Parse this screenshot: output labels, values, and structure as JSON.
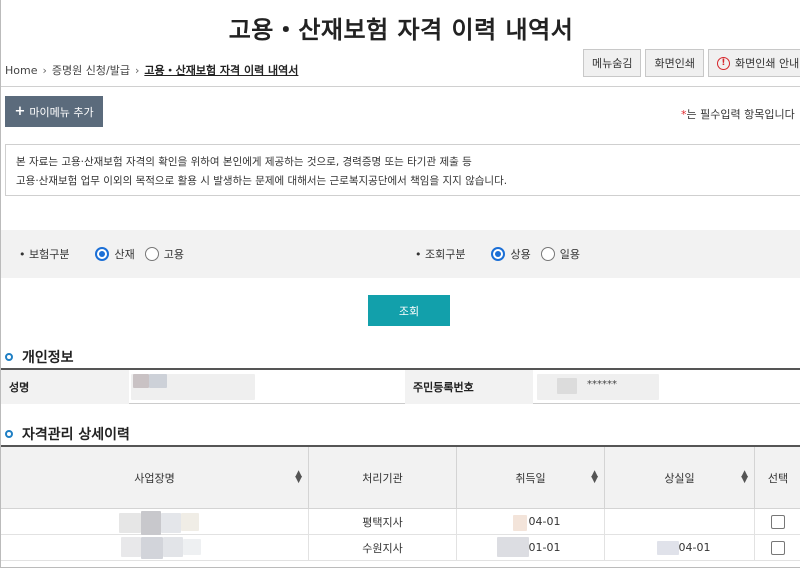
{
  "page": {
    "title": "고용・산재보험 자격 이력 내역서"
  },
  "breadcrumb": {
    "home": "Home",
    "level1": "증명원 신청/발급",
    "current": "고용・산재보험 자격 이력 내역서"
  },
  "top_buttons": {
    "menu_hide": "메뉴숨김",
    "print": "화면인쇄",
    "print_guide": "화면인쇄 안내"
  },
  "my_menu": {
    "label": "마이메뉴 추가"
  },
  "required_note": {
    "star": "*",
    "text": "는 필수입력 항목입니다"
  },
  "notice": {
    "line1": "본 자료는 고용·산재보험 자격의 확인을 위하여 본인에게 제공하는 것으로, 경력증명 또는 타기관 제출 등",
    "line2": "고용·산재보험 업무 이외의 목적으로 활용 시 발생하는 문제에 대해서는 근로복지공단에서 책임을 지지 않습니다."
  },
  "filters": {
    "insurance": {
      "label": "• 보험구분",
      "options": [
        "산재",
        "고용"
      ],
      "selected": "산재"
    },
    "inquiry": {
      "label": "• 조회구분",
      "options": [
        "상용",
        "일용"
      ],
      "selected": "상용"
    }
  },
  "search_button": "조회",
  "personal": {
    "section_title": "개인정보",
    "name_label": "성명",
    "rrn_label": "주민등록번호",
    "rrn_masked": "******"
  },
  "history": {
    "section_title": "자격관리 상세이력",
    "columns": [
      "사업장명",
      "처리기관",
      "취득일",
      "상실일",
      "선택"
    ],
    "rows": [
      {
        "agency": "평택지사",
        "acquired": "04-01",
        "lost": ""
      },
      {
        "agency": "수원지사",
        "acquired": "01-01",
        "lost": "-04-01"
      }
    ]
  },
  "colors": {
    "search_button": "#12a0ab",
    "my_menu": "#5b6b7c",
    "radio_selected": "#1b6fd6",
    "section_bullet": "#1f7fc4",
    "required_star": "#e0282e"
  }
}
